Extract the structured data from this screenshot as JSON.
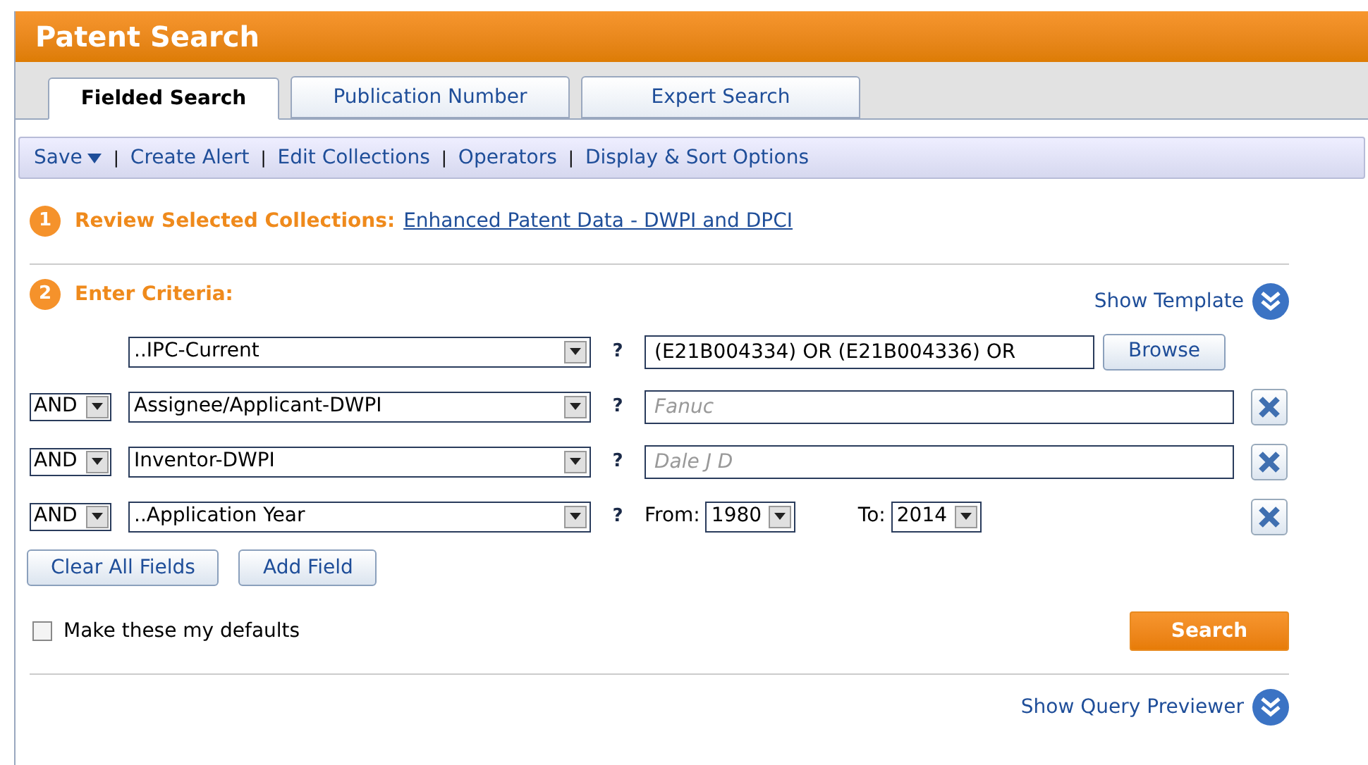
{
  "header": {
    "title": "Patent Search"
  },
  "tabs": [
    {
      "label": "Fielded Search",
      "selected": true
    },
    {
      "label": "Publication Number",
      "selected": false
    },
    {
      "label": "Expert Search",
      "selected": false
    }
  ],
  "toolbar": {
    "save": "Save",
    "links": [
      "Create Alert",
      "Edit Collections",
      "Operators",
      "Display & Sort Options"
    ],
    "separator": "|"
  },
  "step1": {
    "number": "1",
    "label": "Review Selected Collections:",
    "link": "Enhanced Patent Data - DWPI and DPCI"
  },
  "step2": {
    "number": "2",
    "label": "Enter Criteria:",
    "show_template": "Show Template"
  },
  "criteria": [
    {
      "kind": "text",
      "field": "..IPC-Current",
      "help": "?",
      "value": "(E21B004334) OR (E21B004336) OR",
      "browse": "Browse",
      "removable": false
    },
    {
      "kind": "text",
      "operator": "AND",
      "field": "Assignee/Applicant-DWPI",
      "help": "?",
      "placeholder": "Fanuc",
      "removable": true
    },
    {
      "kind": "text",
      "operator": "AND",
      "field": "Inventor-DWPI",
      "help": "?",
      "placeholder": "Dale J D",
      "removable": true
    },
    {
      "kind": "range",
      "operator": "AND",
      "field": "..Application Year",
      "help": "?",
      "from_label": "From:",
      "from": "1980",
      "to_label": "To:",
      "to": "2014",
      "removable": true
    }
  ],
  "buttons": {
    "clear": "Clear All Fields",
    "add": "Add Field",
    "search": "Search"
  },
  "defaults": {
    "label": "Make these my defaults",
    "checked": false
  },
  "footer": {
    "show_query_previewer": "Show Query Previewer"
  }
}
